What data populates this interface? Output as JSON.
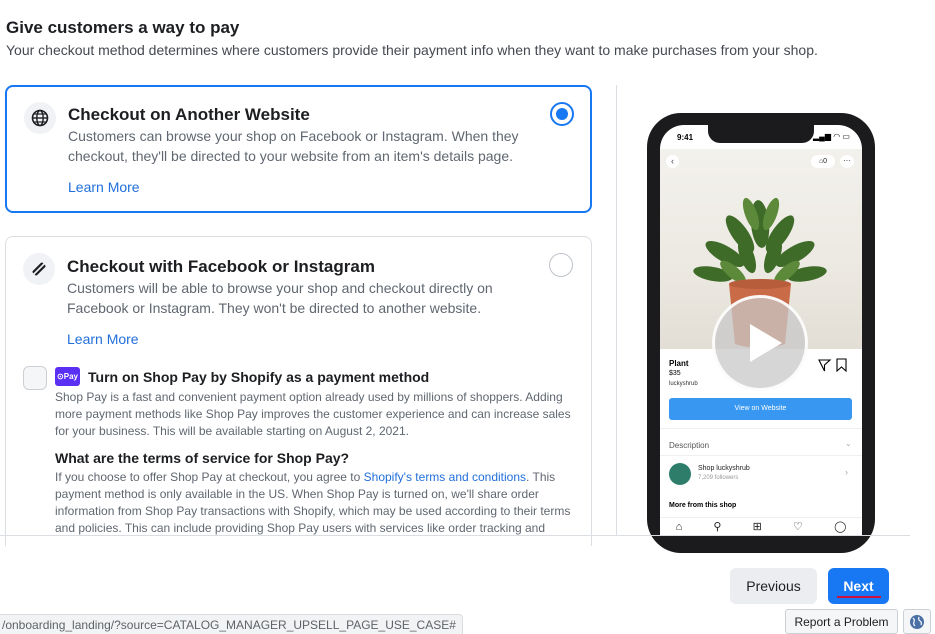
{
  "header": {
    "title": "Give customers a way to pay",
    "subtitle": "Your checkout method determines where customers provide their payment info when they want to make purchases from your shop."
  },
  "options": [
    {
      "title": "Checkout on Another Website",
      "description": "Customers can browse your shop on Facebook or Instagram. When they checkout, they'll be directed to your website from an item's details page.",
      "learn_more": "Learn More",
      "selected": true
    },
    {
      "title": "Checkout with Facebook or Instagram",
      "description": "Customers will be able to browse your shop and checkout directly on Facebook or Instagram. They won't be directed to another website.",
      "learn_more": "Learn More",
      "selected": false
    }
  ],
  "shop_pay": {
    "badge": "⊙Pay",
    "title": "Turn on Shop Pay by Shopify as a payment method",
    "description": "Shop Pay is a fast and convenient payment option already used by millions of shoppers. Adding more payment methods like Shop Pay improves the customer experience and can increase sales for your business. This will be available starting on August 2, 2021.",
    "checked": false,
    "terms_title": "What are the terms of service for Shop Pay?",
    "terms_before": "If you choose to offer Shop Pay at checkout, you agree to ",
    "terms_link": "Shopify's terms and conditions",
    "terms_after": ". This payment method is only available in the US. When Shop Pay is turned on, we'll share order information from Shop Pay transactions with Shopify, which may be used according to their terms and policies. This can include providing Shop Pay users with services like order tracking and"
  },
  "phone": {
    "time": "9:41",
    "status": "▂▄▆ ◠ ▭",
    "cart_count": "⌂0",
    "product_name": "Plant",
    "price": "$35",
    "shop_handle": "luckyshrub",
    "view_button": "View on Website",
    "description_label": "Description",
    "shop_name": "Shop luckyshrub",
    "followers": "7,209 followers",
    "more_from_shop": "More from this shop"
  },
  "footer": {
    "previous": "Previous",
    "next": "Next",
    "status_url": "/onboarding_landing/?source=CATALOG_MANAGER_UPSELL_PAGE_USE_CASE#",
    "report": "Report a Problem"
  },
  "colors": {
    "accent": "#1877f2",
    "link": "#216fdb",
    "shop_pay": "#5a31f4"
  }
}
